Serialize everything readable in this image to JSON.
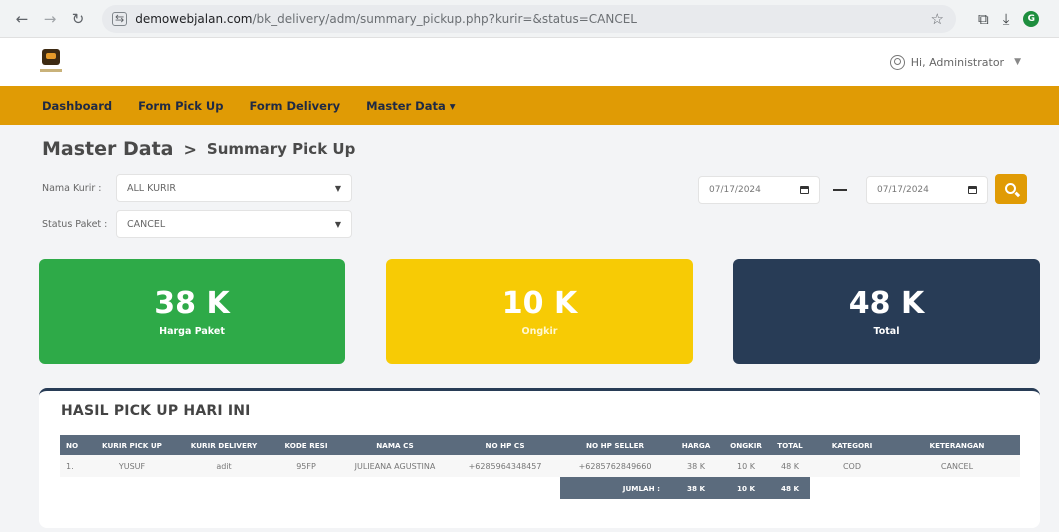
{
  "browser": {
    "url_host": "demowebjalan.com",
    "url_path": "/bk_delivery/adm/summary_pickup.php?kurir=&status=CANCEL",
    "profile_initial": "G"
  },
  "header": {
    "user_greeting": "Hi, Administrator"
  },
  "nav": {
    "items": [
      "Dashboard",
      "Form Pick Up",
      "Form Delivery",
      "Master Data ▾"
    ]
  },
  "breadcrumb": {
    "main": "Master Data",
    "separator": ">",
    "sub": "Summary Pick Up"
  },
  "filters": {
    "kurir_label": "Nama Kurir :",
    "kurir_value": "ALL KURIR",
    "status_label": "Status Paket :",
    "status_value": "CANCEL",
    "date_from": "07/17/2024",
    "date_to": "07/17/2024"
  },
  "cards": [
    {
      "value": "38 K",
      "label": "Harga Paket",
      "color": "#2eaa48"
    },
    {
      "value": "10 K",
      "label": "Ongkir",
      "color": "#f7cb05"
    },
    {
      "value": "48 K",
      "label": "Total",
      "color": "#283c56"
    }
  ],
  "table": {
    "title": "HASIL PICK UP HARI INI",
    "headers": [
      "NO",
      "KURIR PICK UP",
      "KURIR DELIVERY",
      "KODE RESI",
      "NAMA CS",
      "NO HP CS",
      "NO HP SELLER",
      "HARGA",
      "ONGKIR",
      "TOTAL",
      "KATEGORI",
      "KETERANGAN"
    ],
    "rows": [
      [
        "1.",
        "YUSUF",
        "adit",
        "95FP",
        "JULIEANA AGUSTINA",
        "+6285964348457",
        "+6285762849660",
        "38 K",
        "10 K",
        "48 K",
        "COD",
        "CANCEL"
      ]
    ],
    "summary": {
      "label": "JUMLAH :",
      "harga": "38 K",
      "ongkir": "10 K",
      "total": "48 K"
    }
  },
  "colors": {
    "nav_bg": "#e09b05",
    "green": "#2eaa48",
    "yellow": "#f7cb05",
    "navy": "#283c56",
    "table_header": "#5b6b7d"
  }
}
